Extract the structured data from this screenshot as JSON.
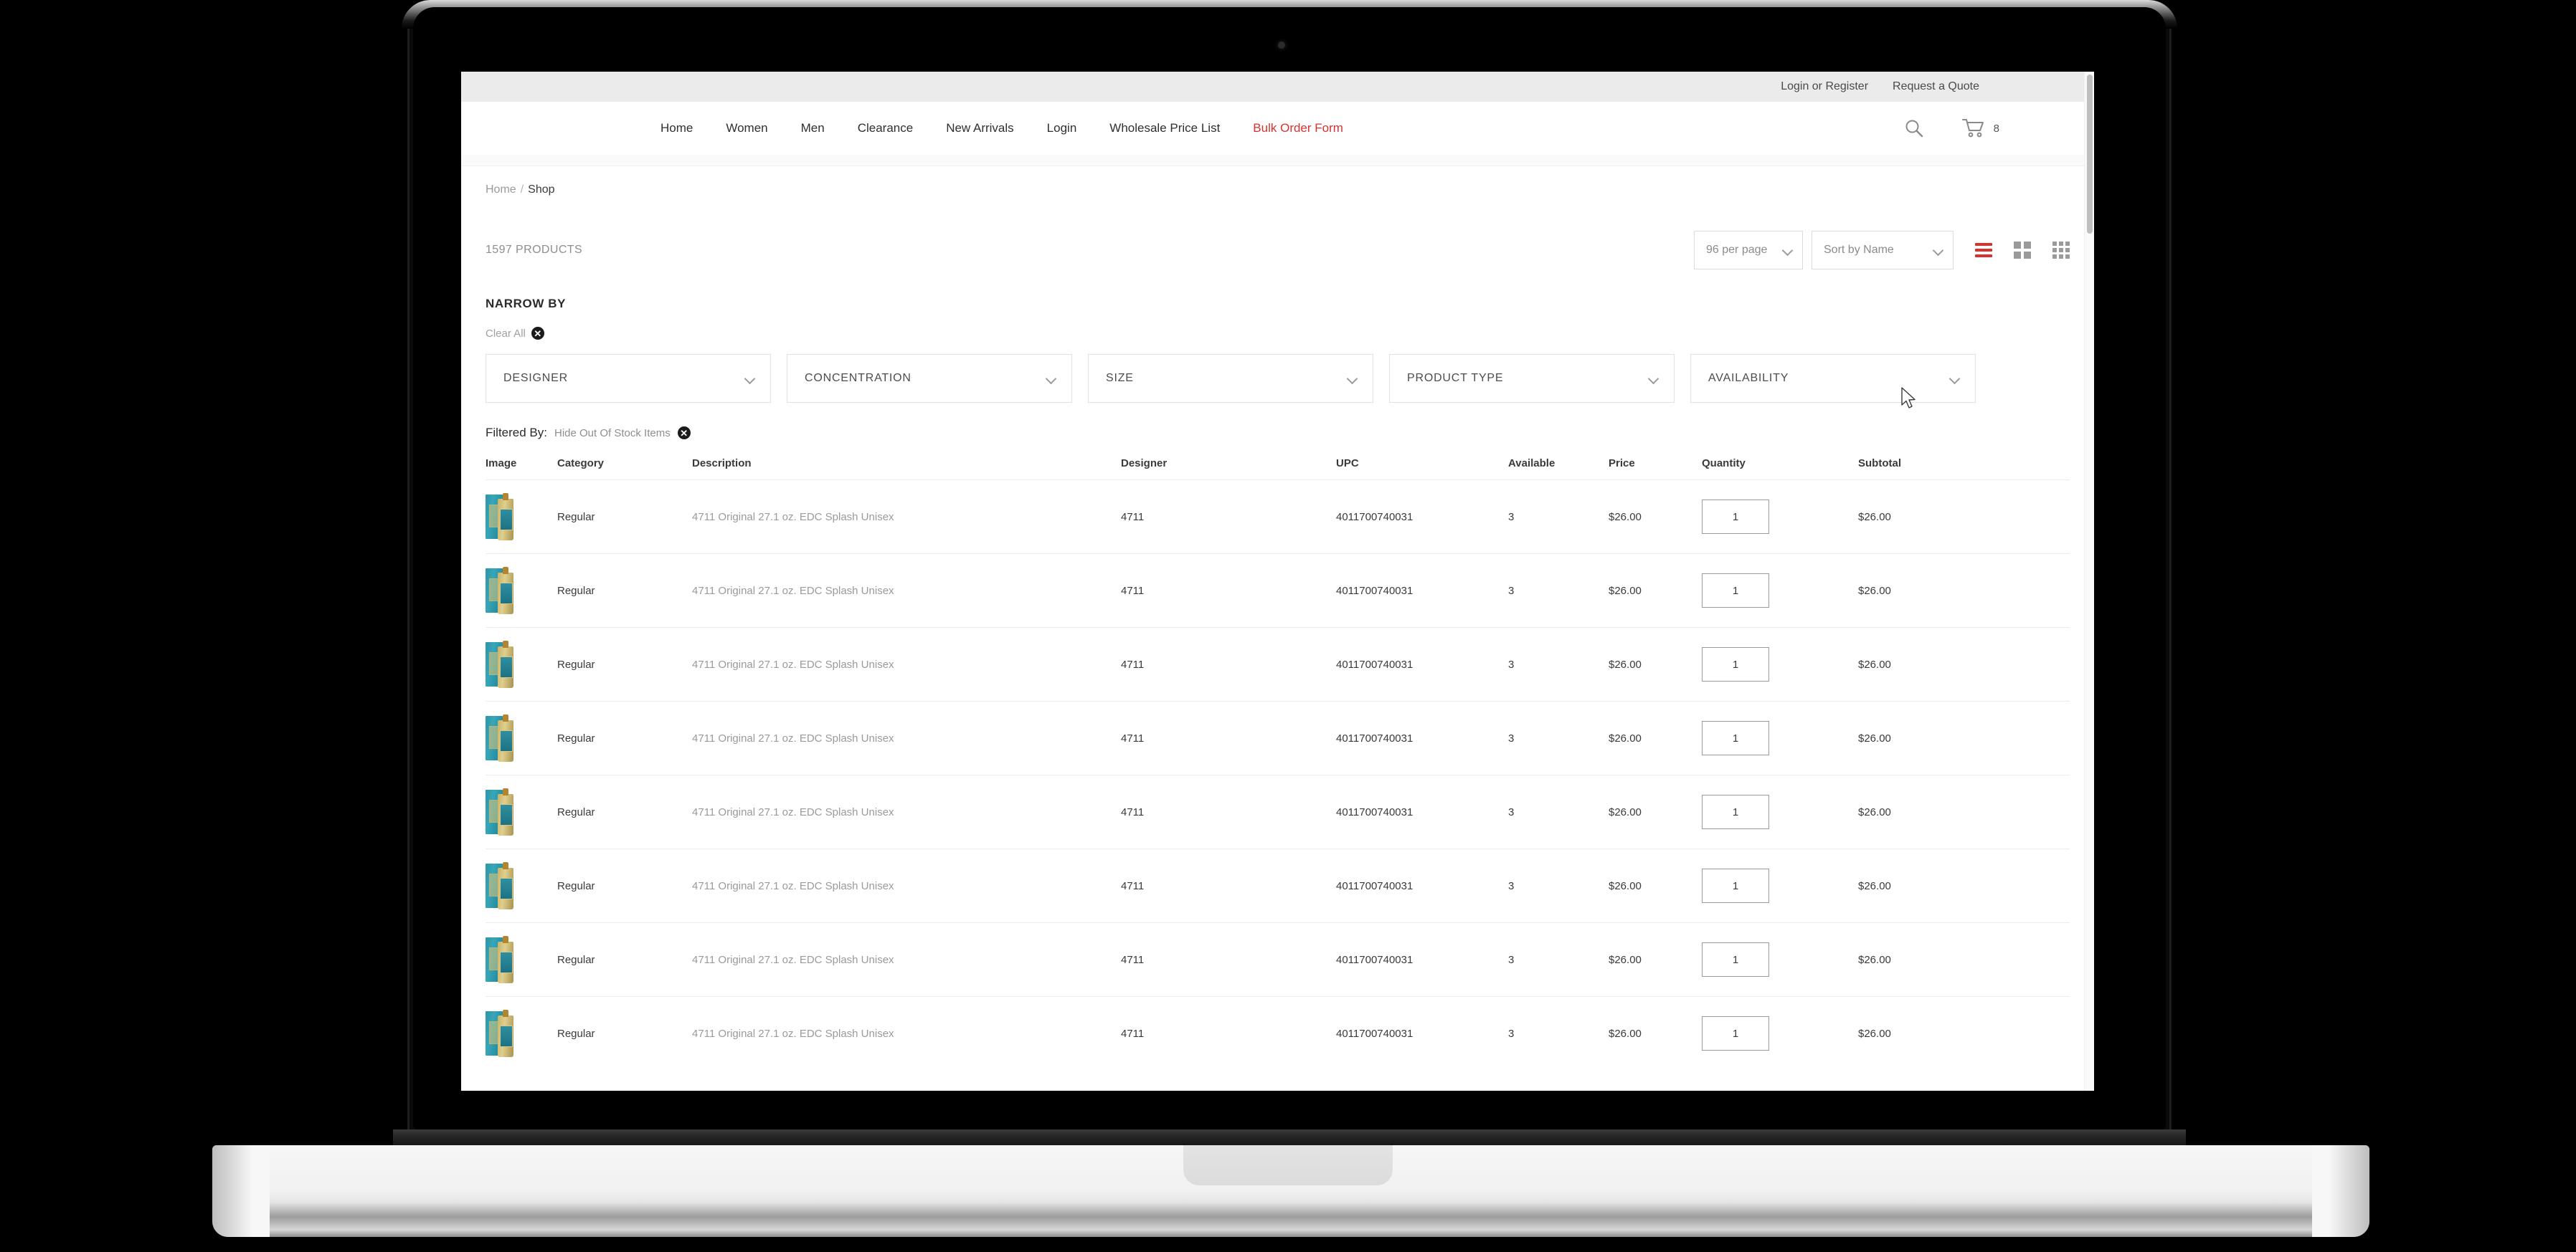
{
  "topbar": {
    "links": [
      {
        "label": "Login or Register",
        "name": "login-or-register-link"
      },
      {
        "label": "Request a Quote",
        "name": "request-a-quote-link"
      }
    ]
  },
  "nav": {
    "items": [
      {
        "label": "Home",
        "accent": false
      },
      {
        "label": "Women",
        "accent": false
      },
      {
        "label": "Men",
        "accent": false
      },
      {
        "label": "Clearance",
        "accent": false
      },
      {
        "label": "New Arrivals",
        "accent": false
      },
      {
        "label": "Login",
        "accent": false
      },
      {
        "label": "Wholesale Price List",
        "accent": false
      },
      {
        "label": "Bulk Order Form",
        "accent": true
      }
    ],
    "accent_color": "#d9322e",
    "search_icon": "search-icon",
    "cart_icon": "shopping-cart-icon",
    "cart_count": "8"
  },
  "breadcrumb": {
    "home": "Home",
    "separator": "/",
    "current": "Shop"
  },
  "toolbar": {
    "product_count": "1597 PRODUCTS",
    "per_page_value": "96 per page",
    "sort_value": "Sort by Name",
    "views": [
      {
        "name": "view-list",
        "active": true
      },
      {
        "name": "view-grid-2",
        "active": false
      },
      {
        "name": "view-grid-3",
        "active": false
      }
    ]
  },
  "narrow": {
    "heading": "NARROW BY",
    "clear_all": "Clear All",
    "clear_all_icon": "close-circle-icon",
    "filters": [
      {
        "label": "DESIGNER",
        "name": "filter-designer"
      },
      {
        "label": "CONCENTRATION",
        "name": "filter-concentration"
      },
      {
        "label": "SIZE",
        "name": "filter-size"
      },
      {
        "label": "PRODUCT TYPE",
        "name": "filter-product-type"
      },
      {
        "label": "AVAILABILITY",
        "name": "filter-availability"
      }
    ]
  },
  "filtered_by": {
    "label": "Filtered By:",
    "value": "Hide Out Of Stock Items",
    "remove_icon": "close-circle-icon"
  },
  "table": {
    "headers": [
      "Image",
      "Category",
      "Description",
      "Designer",
      "UPC",
      "Available",
      "Price",
      "Quantity",
      "Subtotal"
    ],
    "rows": [
      {
        "category": "Regular",
        "description": "4711 Original 27.1 oz. EDC Splash Unisex",
        "designer": "4711",
        "upc": "4011700740031",
        "available": "3",
        "price": "$26.00",
        "quantity": "1",
        "subtotal": "$26.00"
      },
      {
        "category": "Regular",
        "description": "4711 Original 27.1 oz. EDC Splash Unisex",
        "designer": "4711",
        "upc": "4011700740031",
        "available": "3",
        "price": "$26.00",
        "quantity": "1",
        "subtotal": "$26.00"
      },
      {
        "category": "Regular",
        "description": "4711 Original 27.1 oz. EDC Splash Unisex",
        "designer": "4711",
        "upc": "4011700740031",
        "available": "3",
        "price": "$26.00",
        "quantity": "1",
        "subtotal": "$26.00"
      },
      {
        "category": "Regular",
        "description": "4711 Original 27.1 oz. EDC Splash Unisex",
        "designer": "4711",
        "upc": "4011700740031",
        "available": "3",
        "price": "$26.00",
        "quantity": "1",
        "subtotal": "$26.00"
      },
      {
        "category": "Regular",
        "description": "4711 Original 27.1 oz. EDC Splash Unisex",
        "designer": "4711",
        "upc": "4011700740031",
        "available": "3",
        "price": "$26.00",
        "quantity": "1",
        "subtotal": "$26.00"
      },
      {
        "category": "Regular",
        "description": "4711 Original 27.1 oz. EDC Splash Unisex",
        "designer": "4711",
        "upc": "4011700740031",
        "available": "3",
        "price": "$26.00",
        "quantity": "1",
        "subtotal": "$26.00"
      },
      {
        "category": "Regular",
        "description": "4711 Original 27.1 oz. EDC Splash Unisex",
        "designer": "4711",
        "upc": "4011700740031",
        "available": "3",
        "price": "$26.00",
        "quantity": "1",
        "subtotal": "$26.00"
      },
      {
        "category": "Regular",
        "description": "4711 Original 27.1 oz. EDC Splash Unisex",
        "designer": "4711",
        "upc": "4011700740031",
        "available": "3",
        "price": "$26.00",
        "quantity": "1",
        "subtotal": "$26.00"
      }
    ]
  }
}
